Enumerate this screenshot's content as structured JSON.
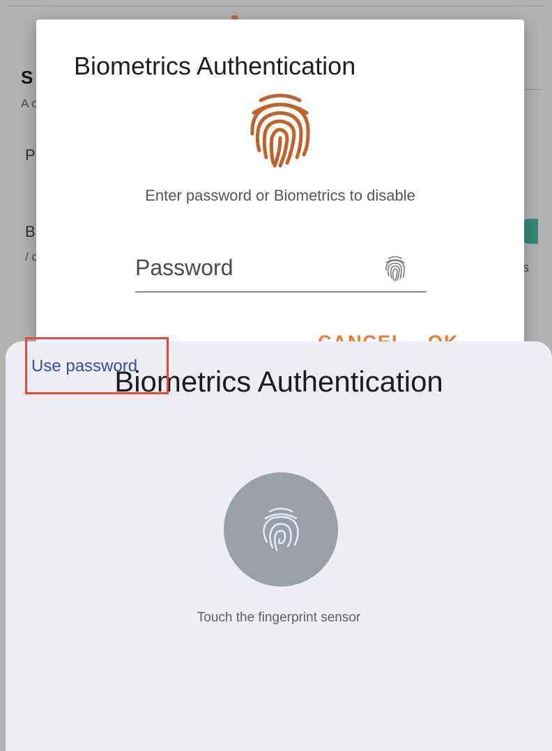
{
  "background": {
    "section_title": "S",
    "section_subtitle": "A op",
    "row_p_label": "P",
    "row_p_value": ")",
    "row_b_label": "B",
    "row_b_sub": "/ c",
    "row_b_sub_right": "is"
  },
  "app_dialog": {
    "title": "Biometrics Authentication",
    "icon": "fingerprint-icon",
    "instruction": "Enter password or Biometrics to disable",
    "password_placeholder": "Password",
    "field_icon": "fingerprint-icon",
    "cancel_label": "CANCEL",
    "ok_label": "OK",
    "accent_color": "#f07a2c",
    "icon_color": "#c0622a"
  },
  "system_sheet": {
    "title": "Biometrics Authentication",
    "sensor_icon": "fingerprint-icon",
    "hint": "Touch the fingerprint sensor",
    "use_password_label": "Use password",
    "link_color": "#3b4ba0",
    "highlight_color": "#e8483a",
    "background_color": "#efedf4"
  }
}
